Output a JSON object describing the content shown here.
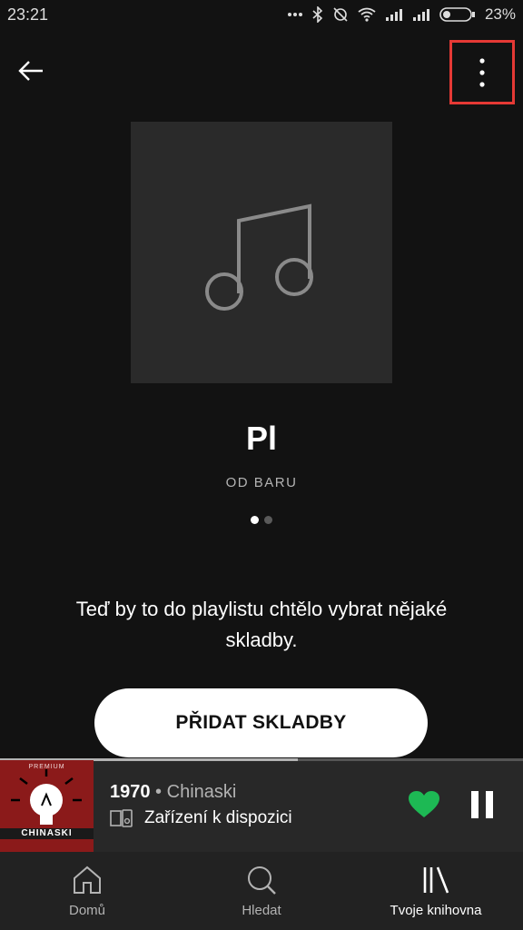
{
  "status": {
    "time": "23:21",
    "battery": "23%"
  },
  "topbar": {
    "back_icon": "arrow-left-icon",
    "more_icon": "more-vertical-icon"
  },
  "playlist": {
    "cover_icon": "music-note-icon",
    "title": "Pl",
    "owner": "OD BARU",
    "page_count": 2,
    "active_page": 1
  },
  "empty_state": {
    "message": "Teď by to do playlistu chtělo vybrat nějaké skladby.",
    "add_button": "PŘIDAT SKLADBY"
  },
  "now_playing": {
    "album_art_top": "PREMIUM",
    "album_art_band": "CHINASKI",
    "title": "1970",
    "separator": " • ",
    "artist": "Chinaski",
    "device": "Zařízení k dispozici",
    "liked": true,
    "progress": 0.57,
    "accent": "#1DB954"
  },
  "nav": {
    "items": [
      {
        "label": "Domů",
        "icon": "home-icon"
      },
      {
        "label": "Hledat",
        "icon": "search-icon"
      },
      {
        "label": "Tvoje knihovna",
        "icon": "library-icon",
        "active": true
      }
    ]
  }
}
